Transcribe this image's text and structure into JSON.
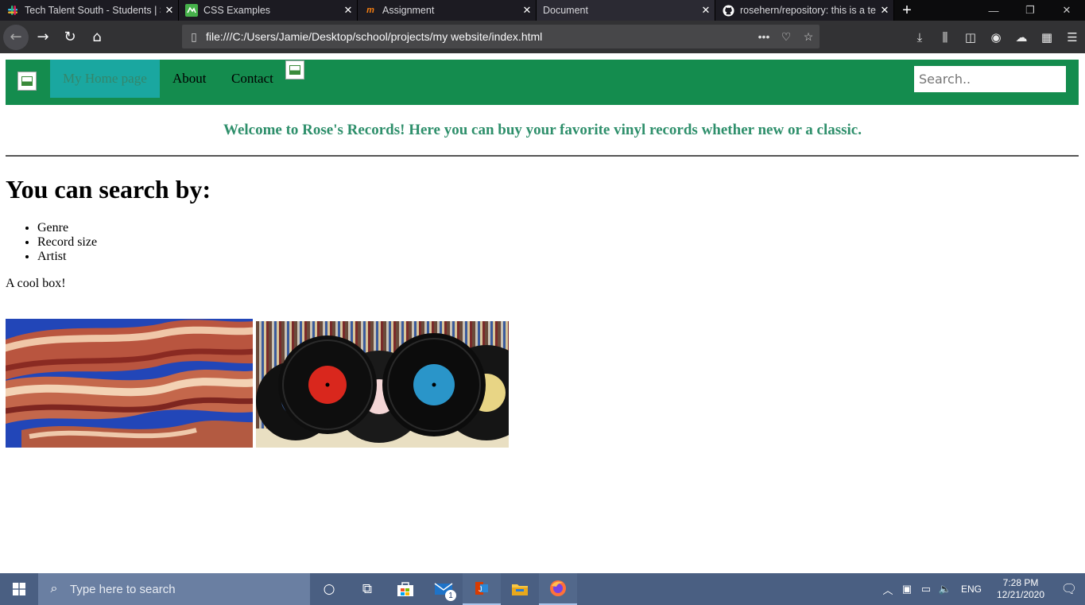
{
  "browser": {
    "tabs": [
      {
        "title": "Tech Talent South - Students | Sl",
        "icon": "slack-icon",
        "color": "#e01e5a"
      },
      {
        "title": "CSS Examples",
        "icon": "codepen-icon",
        "color": "#46b14b"
      },
      {
        "title": "Assignment",
        "icon": "moodle-icon",
        "color": "#f98012"
      },
      {
        "title": "Document",
        "icon": "",
        "color": ""
      },
      {
        "title": "rosehern/repository: this is a te",
        "icon": "github-icon",
        "color": "#ffffff"
      }
    ],
    "new_tab_label": "+",
    "url": "file:///C:/Users/Jamie/Desktop/school/projects/my website/index.html"
  },
  "site": {
    "nav": {
      "items": [
        "My Home page",
        "About",
        "Contact"
      ],
      "search_placeholder": "Search.."
    },
    "welcome": "Welcome to Rose's Records! Here you can buy your favorite vinyl records whether new or a classic.",
    "heading": "You can search by:",
    "search_options": [
      "Genre",
      "Record size",
      "Artist"
    ],
    "cool_box": "A cool box!",
    "colors": {
      "nav_bg": "#148c4e",
      "nav_active": "#1aa7a0",
      "welcome_text": "#2e8f6b"
    }
  },
  "taskbar": {
    "search_placeholder": "Type here to search",
    "mail_badge": "1",
    "language": "ENG",
    "time": "7:28 PM",
    "date": "12/21/2020"
  }
}
